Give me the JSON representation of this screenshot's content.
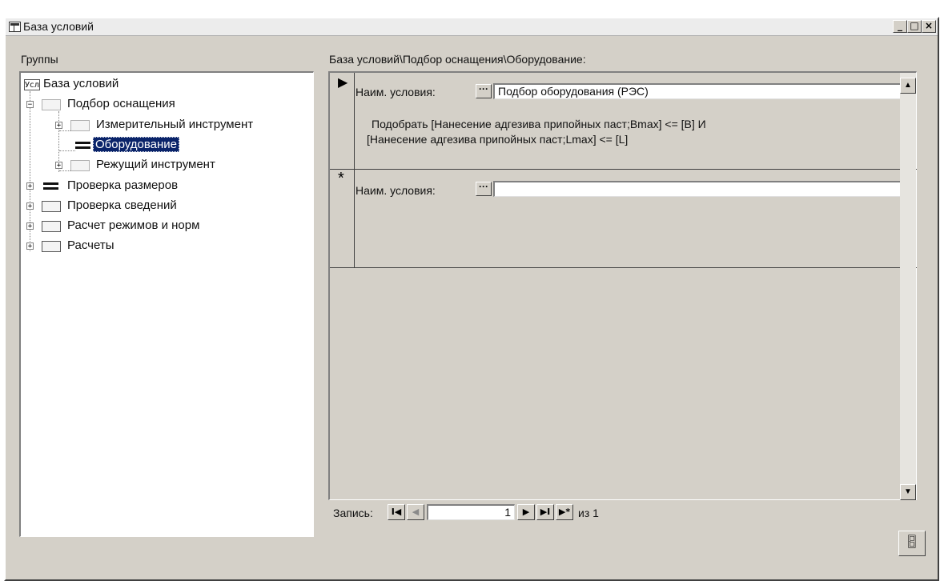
{
  "window": {
    "title": "База условий",
    "btn_min": "_",
    "btn_max": "□",
    "btn_close": "×"
  },
  "left": {
    "label": "Группы",
    "root": {
      "badge": "Усл",
      "label": "База условий"
    },
    "items": [
      {
        "label": "Подбор оснащения",
        "expander": "−"
      },
      {
        "label": "Измерительный инструмент",
        "expander": "+"
      },
      {
        "label": "Оборудование"
      },
      {
        "label": "Режущий инструмент",
        "expander": "+"
      },
      {
        "label": "Проверка размеров",
        "expander": "+"
      },
      {
        "label": "Проверка сведений",
        "expander": "+"
      },
      {
        "label": "Расчет режимов и норм",
        "expander": "+"
      },
      {
        "label": "Расчеты",
        "expander": "+"
      }
    ]
  },
  "right": {
    "path": "База условий\\Подбор оснащения\\Оборудование:",
    "record1": {
      "selector": "▶",
      "field_label": "Наим. условия:",
      "value": "Подбор оборудования (РЭС)",
      "desc1": "Подобрать [Нанесение адгезива припойных паст;Bmax] <= [B] И",
      "desc2": "[Нанесение адгезива припойных паст;Lmax] <= [L]"
    },
    "record2": {
      "selector": "*",
      "field_label": "Наим. условия:",
      "value": ""
    },
    "dots": "···",
    "scroll_up": "▲",
    "scroll_down": "▼"
  },
  "nav": {
    "label": "Запись:",
    "first": "I◀",
    "prev": "◀",
    "current": "1",
    "next": "▶",
    "last": "▶I",
    "new": "▶*",
    "total": "из 1"
  },
  "exit_icon": "door-exit-icon"
}
